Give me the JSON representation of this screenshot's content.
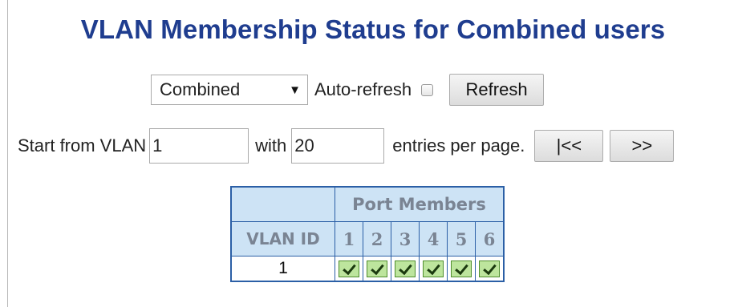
{
  "title": "VLAN Membership Status for Combined users",
  "user_select": {
    "value": "Combined",
    "arrow": "▼"
  },
  "auto_refresh": {
    "label": "Auto-refresh",
    "checked": false
  },
  "refresh_button": "Refresh",
  "paging": {
    "start_label": "Start from VLAN",
    "start_value": "1",
    "with_label": "with",
    "entries_value": "20",
    "entries_label": "entries per page.",
    "first_button": "|<<",
    "next_button": ">>"
  },
  "table": {
    "group_header": "Port Members",
    "vlan_id_header": "VLAN ID",
    "ports": [
      "1",
      "2",
      "3",
      "4",
      "5",
      "6"
    ],
    "rows": [
      {
        "vlan_id": "1",
        "members": [
          true,
          true,
          true,
          true,
          true,
          true
        ]
      }
    ]
  },
  "colors": {
    "title": "#1f3d8f",
    "table_border": "#2b5fa6",
    "header_bg": "#cde3f5",
    "member_bg": "#bde59d"
  }
}
